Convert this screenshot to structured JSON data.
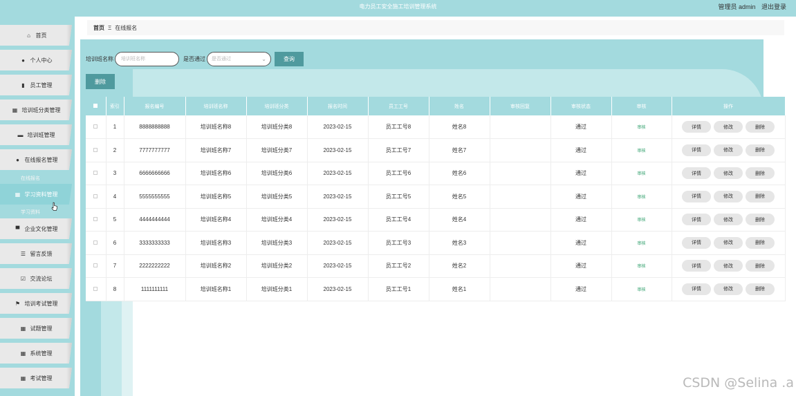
{
  "header": {
    "title": "电力员工安全施工培训管理系统",
    "user_label": "管理员 admin",
    "logout_label": "退出登录"
  },
  "sidebar": {
    "items": [
      {
        "label": "首页",
        "icon": "home-icon",
        "glyph": "⌂"
      },
      {
        "label": "个人中心",
        "icon": "user-icon",
        "glyph": "●"
      },
      {
        "label": "员工管理",
        "icon": "bar-chart-icon",
        "glyph": "▮"
      },
      {
        "label": "培训班分类管理",
        "icon": "grid-icon",
        "glyph": "▦"
      },
      {
        "label": "培训班管理",
        "icon": "chat-icon",
        "glyph": "▬"
      },
      {
        "label": "在线报名管理",
        "icon": "user-icon",
        "glyph": "●"
      },
      {
        "label": "学习资料管理",
        "icon": "grid-icon",
        "glyph": "▦"
      },
      {
        "label": "企业文化管理",
        "icon": "monitor-icon",
        "glyph": "▀"
      },
      {
        "label": "留言反馈",
        "icon": "list-icon",
        "glyph": "☰"
      },
      {
        "label": "交流论坛",
        "icon": "checkbox-icon",
        "glyph": "☑"
      },
      {
        "label": "培训考试管理",
        "icon": "flag-icon",
        "glyph": "⚑"
      },
      {
        "label": "试题管理",
        "icon": "grid-icon",
        "glyph": "▦"
      },
      {
        "label": "系统管理",
        "icon": "grid-icon",
        "glyph": "▦"
      },
      {
        "label": "考试管理",
        "icon": "grid-icon",
        "glyph": "▦"
      }
    ],
    "active_index": 6,
    "ghost_sub_1": "在线报名",
    "ghost_sub_2": "学习资料"
  },
  "breadcrumb": {
    "home": "首页",
    "sep": "Ξ",
    "current": "在线报名"
  },
  "search": {
    "name_label": "培训班名称",
    "name_placeholder": "培训班名称",
    "pass_label": "是否通过",
    "pass_placeholder": "是否通过",
    "query_button": "查询"
  },
  "delete_button": "删除",
  "table": {
    "columns": [
      "",
      "索引",
      "报名编号",
      "培训班名称",
      "培训班分类",
      "报名时间",
      "员工工号",
      "姓名",
      "审核回复",
      "审核状态",
      "审核",
      "操作"
    ],
    "rows": [
      {
        "index": "1",
        "code": "8888888888",
        "class_name": "培训班名称8",
        "category": "培训班分类8",
        "date": "2023-02-15",
        "emp_no": "员工工号8",
        "name": "姓名8",
        "reply": "",
        "status": "通过",
        "audit": "审核"
      },
      {
        "index": "2",
        "code": "7777777777",
        "class_name": "培训班名称7",
        "category": "培训班分类7",
        "date": "2023-02-15",
        "emp_no": "员工工号7",
        "name": "姓名7",
        "reply": "",
        "status": "通过",
        "audit": "审核"
      },
      {
        "index": "3",
        "code": "6666666666",
        "class_name": "培训班名称6",
        "category": "培训班分类6",
        "date": "2023-02-15",
        "emp_no": "员工工号6",
        "name": "姓名6",
        "reply": "",
        "status": "通过",
        "audit": "审核"
      },
      {
        "index": "4",
        "code": "5555555555",
        "class_name": "培训班名称5",
        "category": "培训班分类5",
        "date": "2023-02-15",
        "emp_no": "员工工号5",
        "name": "姓名5",
        "reply": "",
        "status": "通过",
        "audit": "审核"
      },
      {
        "index": "5",
        "code": "4444444444",
        "class_name": "培训班名称4",
        "category": "培训班分类4",
        "date": "2023-02-15",
        "emp_no": "员工工号4",
        "name": "姓名4",
        "reply": "",
        "status": "通过",
        "audit": "审核"
      },
      {
        "index": "6",
        "code": "3333333333",
        "class_name": "培训班名称3",
        "category": "培训班分类3",
        "date": "2023-02-15",
        "emp_no": "员工工号3",
        "name": "姓名3",
        "reply": "",
        "status": "通过",
        "audit": "审核"
      },
      {
        "index": "7",
        "code": "2222222222",
        "class_name": "培训班名称2",
        "category": "培训班分类2",
        "date": "2023-02-15",
        "emp_no": "员工工号2",
        "name": "姓名2",
        "reply": "",
        "status": "通过",
        "audit": "审核"
      },
      {
        "index": "8",
        "code": "1111111111",
        "class_name": "培训班名称1",
        "category": "培训班分类1",
        "date": "2023-02-15",
        "emp_no": "员工工号1",
        "name": "姓名1",
        "reply": "",
        "status": "通过",
        "audit": "审核"
      }
    ],
    "actions": {
      "detail": "详情",
      "edit": "修改",
      "delete": "删除"
    }
  },
  "watermark": "CSDN @Selina .a",
  "colors": {
    "teal": "#a3dade",
    "button": "#4f9a9e",
    "audit_text": "#2e9e6a"
  }
}
